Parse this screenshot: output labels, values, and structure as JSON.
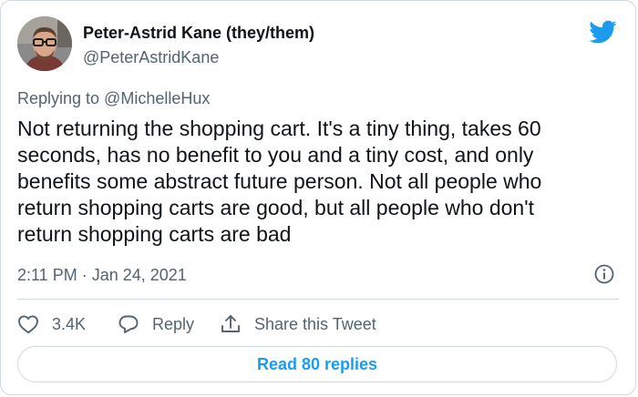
{
  "author": {
    "name": "Peter-Astrid Kane (they/them)",
    "handle": "@PeterAstridKane",
    "avatar": "avatar"
  },
  "brand": {
    "icon": "twitter-bird-icon",
    "color": "#1d9bf0"
  },
  "tweet": {
    "replying_to": "Replying to @MichelleHux",
    "text": "Not returning the shopping cart. It's a tiny thing, takes 60\nseconds, has no benefit to you and a tiny cost, and only\nbenefits some abstract future person. Not all people who\nreturn shopping carts are good, but all people who don't\nreturn shopping carts are bad",
    "timestamp": "2:11 PM · Jan 24, 2021"
  },
  "actions": {
    "like_count": "3.4K",
    "reply_label": "Reply",
    "share_label": "Share this Tweet"
  },
  "footer": {
    "read_replies_label": "Read 80 replies"
  },
  "colors": {
    "text_primary": "#0f1419",
    "text_secondary": "#536471",
    "border": "#cfd9de",
    "accent": "#1d9bf0"
  }
}
